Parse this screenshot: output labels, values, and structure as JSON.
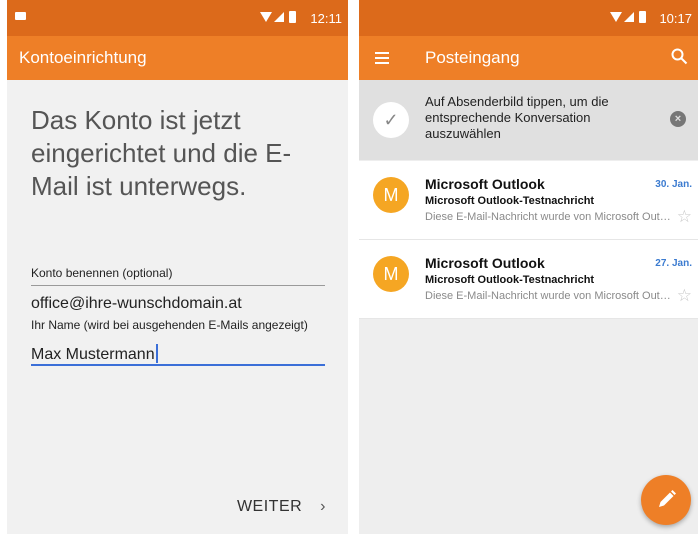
{
  "left_screen": {
    "status": {
      "time": "12:11"
    },
    "appbar": {
      "title": "Kontoeinrichtung"
    },
    "heading": "Das Konto ist jetzt eingerichtet und die E-Mail ist unterwegs.",
    "account_name": {
      "label": "Konto benennen (optional)",
      "value": "office@ihre-wunschdomain.at"
    },
    "your_name": {
      "label": "Ihr Name (wird bei ausgehenden E-Mails angezeigt)",
      "value": "Max Mustermann"
    },
    "next_button": {
      "label": "WEITER",
      "chevron": "›"
    }
  },
  "right_screen": {
    "status": {
      "time": "10:17"
    },
    "appbar": {
      "title": "Posteingang",
      "menu_icon": "hamburger-menu-icon",
      "search_icon": "search-icon"
    },
    "hint": {
      "text": "Auf Absenderbild tippen, um die entsprechende Konversation auszuwählen",
      "check_icon": "✓",
      "close_icon": "×"
    },
    "emails": [
      {
        "avatar": "M",
        "sender": "Microsoft Outlook",
        "date": "30. Jan.",
        "subject": "Microsoft Outlook-Testnachricht",
        "preview": "Diese E-Mail-Nachricht wurde von Microsoft Outlook gesendet",
        "star": "☆"
      },
      {
        "avatar": "M",
        "sender": "Microsoft Outlook",
        "date": "27. Jan.",
        "subject": "Microsoft Outlook-Testnachricht",
        "preview": "Diese E-Mail-Nachricht wurde von Microsoft Outlook gesendet",
        "star": "☆"
      }
    ],
    "fab": {
      "icon": "pencil-compose-icon"
    }
  },
  "colors": {
    "status_bar": "#dc6a1b",
    "app_bar": "#ee7f27",
    "accent_blue": "#3b6fd8",
    "avatar": "#f5a623"
  }
}
